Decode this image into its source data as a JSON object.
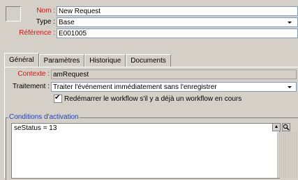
{
  "header": {
    "name_label": "Nom :",
    "name_value": "New Request",
    "type_label": "Type :",
    "type_value": "Base",
    "reference_label": "Référence :",
    "reference_value": "E001005"
  },
  "tabs": [
    {
      "label": "Général",
      "active": true
    },
    {
      "label": "Paramètres",
      "active": false
    },
    {
      "label": "Historique",
      "active": false
    },
    {
      "label": "Documents",
      "active": false
    }
  ],
  "general": {
    "context_label": "Contexte :",
    "context_value": "amRequest",
    "treatment_label": "Traitement :",
    "treatment_value": "Traiter l'événement immédiatement sans l'enregistrer",
    "restart_checkbox_label": "Redémarrer le workflow s'il y a déjà un workflow en cours",
    "restart_checked": true,
    "conditions_label": "Conditions d'activation",
    "conditions_text": "seStatus = 13"
  },
  "colors": {
    "window_bg": "#d4d0c8",
    "required_label": "#e01010",
    "group_title": "#2040c0",
    "field_border": "#7f9db9"
  },
  "icons": [
    "dropdown-arrow-icon",
    "scroll-up-icon",
    "zoom-icon",
    "checkmark-icon"
  ]
}
